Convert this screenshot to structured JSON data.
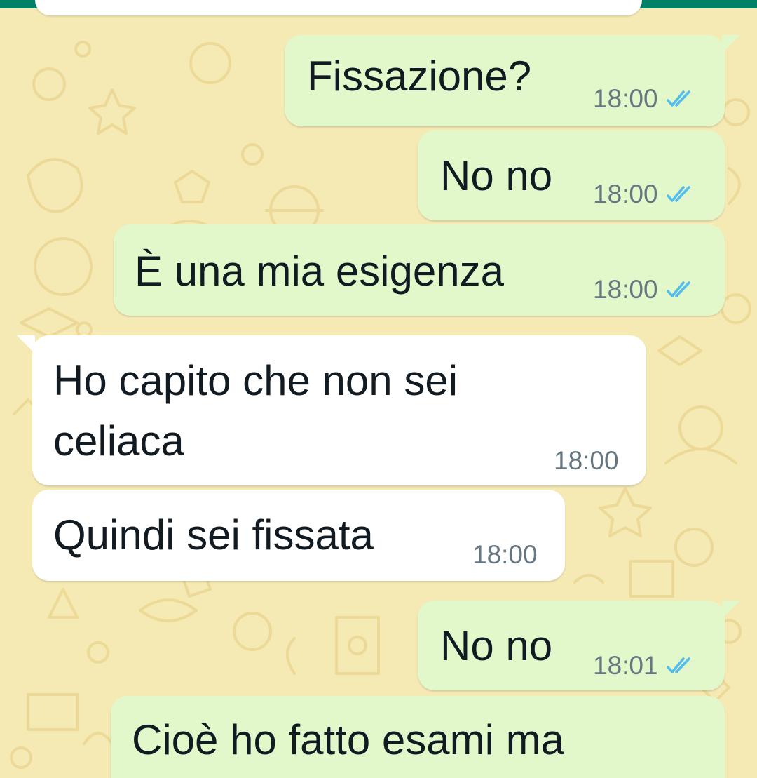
{
  "colors": {
    "outgoing_bubble": "#e2f8cb",
    "incoming_bubble": "#ffffff",
    "wallpaper": "#f5e9b4",
    "header": "#008069",
    "read_ticks": "#53bdeb",
    "timestamp": "#667781",
    "text": "#111b21"
  },
  "messages": [
    {
      "direction": "outgoing",
      "text": "Fissazione?",
      "time": "18:00",
      "status": "read",
      "icon": "double-check-icon"
    },
    {
      "direction": "outgoing",
      "text": "No no",
      "time": "18:00",
      "status": "read",
      "icon": "double-check-icon"
    },
    {
      "direction": "outgoing",
      "text": "È una mia esigenza",
      "time": "18:00",
      "status": "read",
      "icon": "double-check-icon"
    },
    {
      "direction": "incoming",
      "lines": [
        "Ho capito che non sei",
        "celiaca"
      ],
      "time": "18:00"
    },
    {
      "direction": "incoming",
      "text": "Quindi sei fissata",
      "time": "18:00"
    },
    {
      "direction": "outgoing",
      "text": "No no",
      "time": "18:01",
      "status": "read",
      "icon": "double-check-icon"
    },
    {
      "direction": "outgoing",
      "text": "Cioè ho fatto esami ma",
      "partial": true
    }
  ]
}
